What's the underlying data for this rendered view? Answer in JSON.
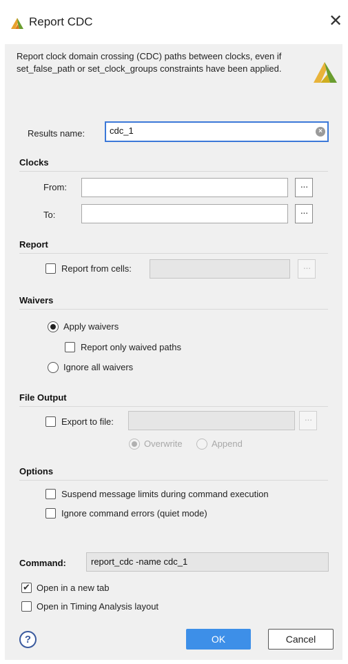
{
  "window": {
    "title": "Report CDC",
    "close_label": "✕"
  },
  "description": "Report clock domain crossing (CDC) paths between clocks, even if set_false_path or set_clock_groups constraints have been applied.",
  "results": {
    "label": "Results name:",
    "value": "cdc_1"
  },
  "clocks": {
    "heading": "Clocks",
    "from_label": "From:",
    "from_value": "",
    "to_label": "To:",
    "to_value": "",
    "browse_label": "···"
  },
  "report": {
    "heading": "Report",
    "from_cells_label": "Report from cells:",
    "from_cells_checked": false,
    "from_cells_value": ""
  },
  "waivers": {
    "heading": "Waivers",
    "apply_label": "Apply waivers",
    "report_only_label": "Report only waived paths",
    "ignore_label": "Ignore all waivers",
    "selected": "apply"
  },
  "file_output": {
    "heading": "File Output",
    "export_label": "Export to file:",
    "export_value": "",
    "overwrite_label": "Overwrite",
    "append_label": "Append"
  },
  "options": {
    "heading": "Options",
    "suspend_label": "Suspend message limits during command execution",
    "ignore_errors_label": "Ignore command errors (quiet mode)"
  },
  "command": {
    "label": "Command:",
    "value": "report_cdc -name cdc_1"
  },
  "footer_options": {
    "open_new_tab_label": "Open in a new tab",
    "open_new_tab_checked": true,
    "open_timing_label": "Open in Timing Analysis layout",
    "open_timing_checked": false
  },
  "buttons": {
    "help": "?",
    "ok": "OK",
    "cancel": "Cancel"
  },
  "colors": {
    "accent": "#3d8fe8",
    "focus_border": "#3b78d8",
    "logo_primary": "#e8b33a",
    "logo_secondary": "#6a9d2f"
  }
}
